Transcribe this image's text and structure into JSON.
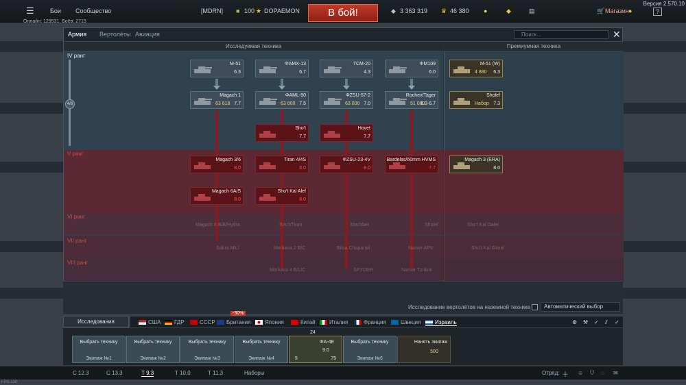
{
  "header": {
    "menu_icon": "hamburger-icon",
    "battles": "Бои",
    "community": "Сообщество",
    "clan_tag": "[MDRN]",
    "level": "100",
    "nickname": "DOPAEMON",
    "fight_button": "В бой!",
    "silver": "3 363 319",
    "gold": "46 380",
    "shop": "Магазин",
    "help": "?",
    "online": "Онлайн: 129531, Боёв: 2715",
    "version": "Версия 2.570.10"
  },
  "research": {
    "tabs": [
      "Армия",
      "Вертолёты",
      "Авиация"
    ],
    "search_placeholder": "Поиск...",
    "col_researched": "Исследуемая техника",
    "col_premium": "Премиумная техника",
    "rank_iv": "IV ранг",
    "rank_progress": "4/6",
    "rank_v": "V ранг",
    "rank_vi": "VI ранг",
    "rank_vii": "VII ранг",
    "rank_viii": "VIII ранг",
    "row1": [
      {
        "name": "M-51",
        "br": "6.3"
      },
      {
        "name": "ΦAMX-13",
        "br": "6.7"
      },
      {
        "name": "TCM-20",
        "br": "4.3"
      },
      {
        "name": "ΦM109",
        "br": "6.0"
      }
    ],
    "row2": [
      {
        "name": "Magach 1",
        "cost": "63 618",
        "br": "7.7"
      },
      {
        "name": "ΦAML-90",
        "cost": "63 000",
        "br": "7.5"
      },
      {
        "name": "ΦZSU-57-2",
        "cost": "63 000",
        "br": "7.0"
      },
      {
        "name": "Rochev/Tager",
        "cost": "51 000",
        "br": "6.3-6.7"
      }
    ],
    "row3": [
      {
        "name": "Sho't",
        "br": "7.7"
      },
      {
        "name": "Hovet",
        "br": "7.7"
      }
    ],
    "row4": [
      {
        "name": "Magach 3/6",
        "br": "8.0"
      },
      {
        "name": "Tiran 4/4S",
        "br": "8.0"
      },
      {
        "name": "ΦZSU-23-4V",
        "br": "8.0"
      },
      {
        "name": "Bardelas/60mm HVMS",
        "br": "7.7"
      }
    ],
    "row5": [
      {
        "name": "Magach 6A/S",
        "br": "8.0"
      },
      {
        "name": "Sho't Kal Alef",
        "br": "8.0"
      }
    ],
    "faded": [
      "Magach 6 B/B/Hydra",
      "Sho't/Tiran",
      "Machbet",
      "Sholef",
      "Sho't Kal Dalet",
      "Sabra Mk.I",
      "Merkava 2 B/C",
      "Bitsa Chaparral",
      "Namer APV",
      "Sho't Kal Gimel",
      "Merkava 4 B/LIC",
      "SPYDER",
      "Namer Tzrikim"
    ],
    "premium": [
      {
        "name": "M-51 (W)",
        "cost": "4 880",
        "br": "6.3"
      },
      {
        "name": "Sholef",
        "cost": "Набор",
        "br": "7.3"
      },
      {
        "name": "Magach 3 (ERA)",
        "br": "8.0"
      }
    ]
  },
  "bottom": {
    "heli_research": "Исследование вертолётов на наземной технике",
    "auto_select": "Автоматический выбор",
    "research_tab": "Исследования",
    "nations": [
      "США",
      "ГДР",
      "СССР",
      "Британия",
      "Япония",
      "Китай",
      "Италия",
      "Франция",
      "Швеция",
      "Израиль"
    ],
    "discount": "-30%"
  },
  "crew": [
    {
      "title": "Выбрать технику",
      "label": "Экипаж №1"
    },
    {
      "title": "Выбрать технику",
      "label": "Экипаж №2"
    },
    {
      "title": "Выбрать технику",
      "label": "Экипаж №3"
    },
    {
      "title": "Выбрать технику",
      "label": "Экипаж №4"
    },
    {
      "title": "ΦA-4E",
      "label": "9.0",
      "count": "24",
      "left": "5",
      "right": "75"
    },
    {
      "title": "Выбрать технику",
      "label": "Экипаж №6"
    },
    {
      "title": "Нанять экипаж",
      "label": "500"
    }
  ],
  "footer": {
    "modes": [
      "С 12.3",
      "С 13.3",
      "Т 9.3",
      "Т 10.0",
      "Т 11.3",
      "Наборы"
    ],
    "squad": "Отряд:",
    "fps": "FPS 130"
  }
}
